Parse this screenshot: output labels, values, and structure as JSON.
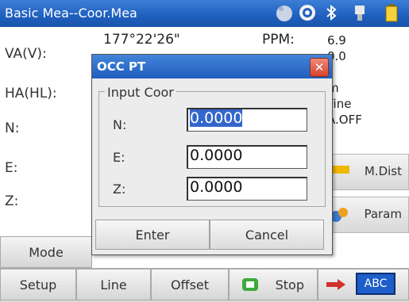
{
  "window": {
    "title": "Basic Mea--Coor.Mea"
  },
  "status_icons": [
    "moon-icon",
    "gear-icon",
    "bluetooth-icon",
    "plug-icon",
    "battery-icon"
  ],
  "background": {
    "labels": {
      "va": "VA(V):",
      "ha": "HA(HL):",
      "n": "N:",
      "e": "E:",
      "z": "Z:"
    },
    "va_value_partial": "177°22'26\"",
    "ppm_label": "PPM:",
    "right_values": [
      "6.9",
      "0.0",
      "m",
      "Fine",
      "A.OFF"
    ]
  },
  "side_buttons": {
    "mdist": "M.Dist",
    "param": "Param"
  },
  "bottom_bar": {
    "mode": "Mode",
    "setup": "Setup",
    "line": "Line",
    "offset": "Offset",
    "stop": "Stop",
    "input_mode": "ABC"
  },
  "dialog": {
    "title": "OCC PT",
    "group_label": "Input Coor",
    "fields": [
      {
        "label": "N:",
        "value": "0.0000"
      },
      {
        "label": "E:",
        "value": "0.0000"
      },
      {
        "label": "Z:",
        "value": "0.0000"
      }
    ],
    "enter_label": "Enter",
    "cancel_label": "Cancel"
  },
  "colors": {
    "titlebar": "#1f5fbf",
    "close": "#d6432d",
    "selection": "#3366cc"
  }
}
